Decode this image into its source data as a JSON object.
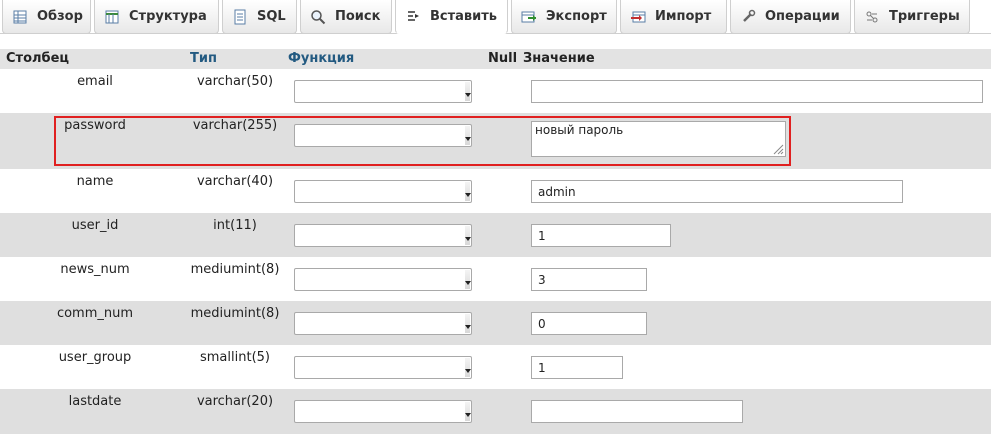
{
  "tabs": [
    {
      "label": "Обзор",
      "icon": "table-browse-icon"
    },
    {
      "label": "Структура",
      "icon": "structure-icon"
    },
    {
      "label": "SQL",
      "icon": "sql-icon"
    },
    {
      "label": "Поиск",
      "icon": "search-icon"
    },
    {
      "label": "Вставить",
      "icon": "insert-icon",
      "active": true
    },
    {
      "label": "Экспорт",
      "icon": "export-icon"
    },
    {
      "label": "Импорт",
      "icon": "import-icon"
    },
    {
      "label": "Операции",
      "icon": "wrench-icon"
    },
    {
      "label": "Триггеры",
      "icon": "triggers-icon"
    }
  ],
  "table": {
    "headers": {
      "column": "Столбец",
      "type": "Тип",
      "function": "Функция",
      "null": "Null",
      "value": "Значение"
    },
    "rows": [
      {
        "column": "email",
        "type": "varchar(50)",
        "function": "",
        "value": ""
      },
      {
        "column": "password",
        "type": "varchar(255)",
        "function": "",
        "value": "новый пароль"
      },
      {
        "column": "name",
        "type": "varchar(40)",
        "function": "",
        "value": "admin"
      },
      {
        "column": "user_id",
        "type": "int(11)",
        "function": "",
        "value": "1"
      },
      {
        "column": "news_num",
        "type": "mediumint(8)",
        "function": "",
        "value": "3"
      },
      {
        "column": "comm_num",
        "type": "mediumint(8)",
        "function": "",
        "value": "0"
      },
      {
        "column": "user_group",
        "type": "smallint(5)",
        "function": "",
        "value": "1"
      },
      {
        "column": "lastdate",
        "type": "varchar(20)",
        "function": "",
        "value": ""
      }
    ]
  },
  "colors": {
    "highlight": "#e02020",
    "header_link": "#235a81",
    "row_alt": "#dfdfdf"
  }
}
